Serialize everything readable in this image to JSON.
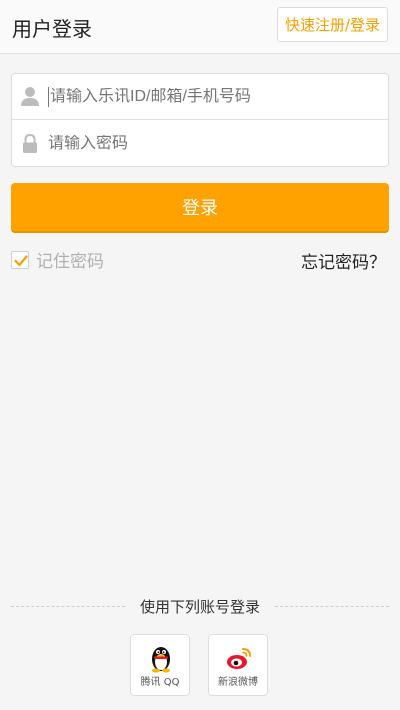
{
  "header": {
    "title": "用户登录",
    "quick_register": "快速注册/登录"
  },
  "form": {
    "account_placeholder": "请输入乐讯ID/邮箱/手机号码",
    "account_icon": "user-icon",
    "password_placeholder": "请输入密码",
    "password_icon": "lock-icon"
  },
  "login_button": "登录",
  "remember": {
    "label": "记住密码",
    "checked": true
  },
  "forgot_password": "忘记密码？",
  "third_party": {
    "title": "使用下列账号登录",
    "items": [
      {
        "label": "腾讯 QQ",
        "icon": "qq-penguin-icon"
      },
      {
        "label": "新浪微博",
        "icon": "weibo-icon"
      }
    ]
  },
  "colors": {
    "accent": "#ffa200",
    "quick_text": "#f5a000",
    "background": "#f5f5f5"
  }
}
